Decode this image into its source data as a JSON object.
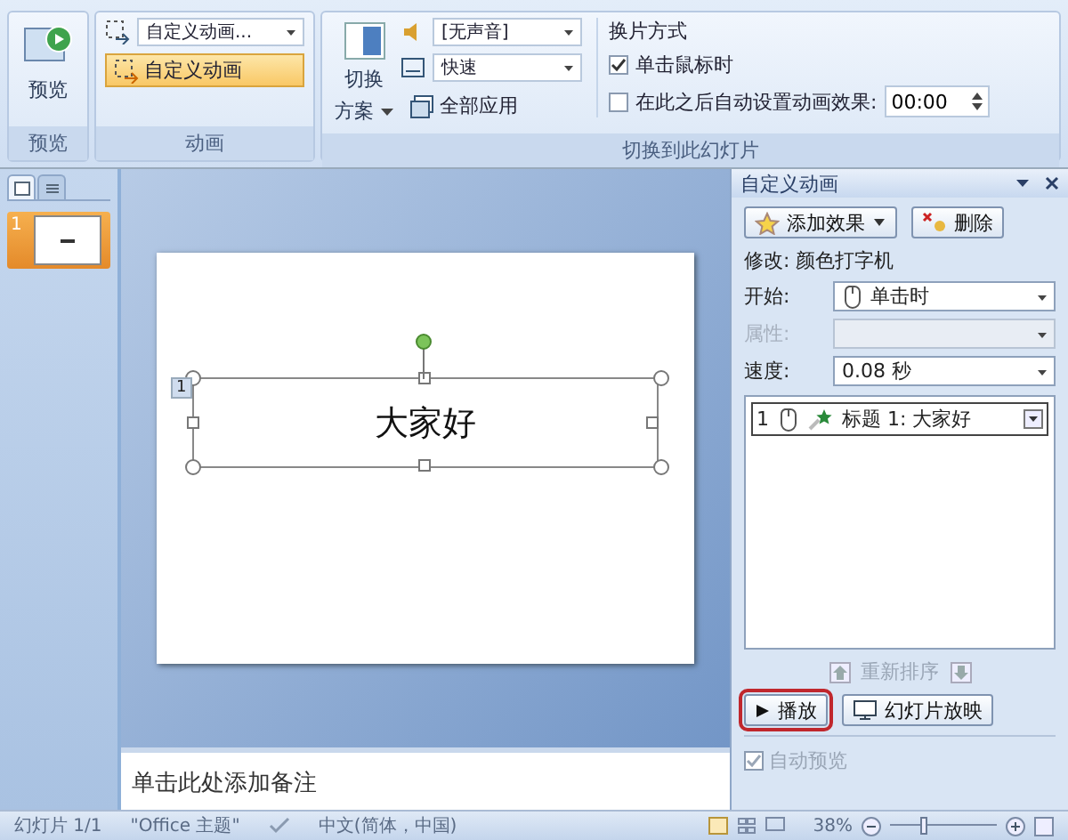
{
  "ribbon": {
    "preview_group": {
      "button": "预览",
      "group_label": "预览"
    },
    "animation_group": {
      "dropdown": "自定义动画...",
      "custom_button": {
        "label": "自定义动画",
        "selected": true
      },
      "group_label": "动画"
    },
    "transition_group": {
      "scheme_button": [
        "切换",
        "方案"
      ],
      "sound": "[无声音]",
      "speed": "快速",
      "apply_all": "全部应用",
      "advance_title": "换片方式",
      "on_click": {
        "label": "单击鼠标时",
        "checked": true
      },
      "auto_after": {
        "label": "在此之后自动设置动画效果:",
        "checked": false,
        "value": "00:00"
      },
      "group_label": "切换到此幻灯片"
    }
  },
  "slide_pane": {
    "tabs": [
      {
        "kind": "slides",
        "selected": true
      },
      {
        "kind": "outline",
        "selected": false
      }
    ],
    "thumbnails": [
      {
        "number": "1",
        "selected": true
      }
    ]
  },
  "slide": {
    "title": "大家好",
    "animation_tag": "1"
  },
  "notes": {
    "placeholder": "单击此处添加备注"
  },
  "task_pane": {
    "title": "自定义动画",
    "add_effect": "添加效果",
    "remove": "删除",
    "modify": "修改: 颜色打字机",
    "fields": [
      {
        "label": "开始:",
        "value": "单击时",
        "kind": "trigger",
        "disabled": false
      },
      {
        "label": "属性:",
        "kind": "plain",
        "disabled": true
      },
      {
        "label": "速度:",
        "value": "0.08 秒",
        "kind": "plain",
        "disabled": false
      }
    ],
    "effects": [
      {
        "number": "1",
        "text": "标题 1: 大家好",
        "selected": true
      }
    ],
    "reorder": "重新排序",
    "play": "播放",
    "slideshow": "幻灯片放映",
    "autopreview": {
      "label": "自动预览",
      "checked": true
    }
  },
  "status_bar": {
    "slide": "幻灯片 1/1",
    "theme": "\"Office 主题\"",
    "language": "中文(简体，中国)",
    "zoom": "38%",
    "zoom_slider": {
      "level": 0.3
    }
  }
}
